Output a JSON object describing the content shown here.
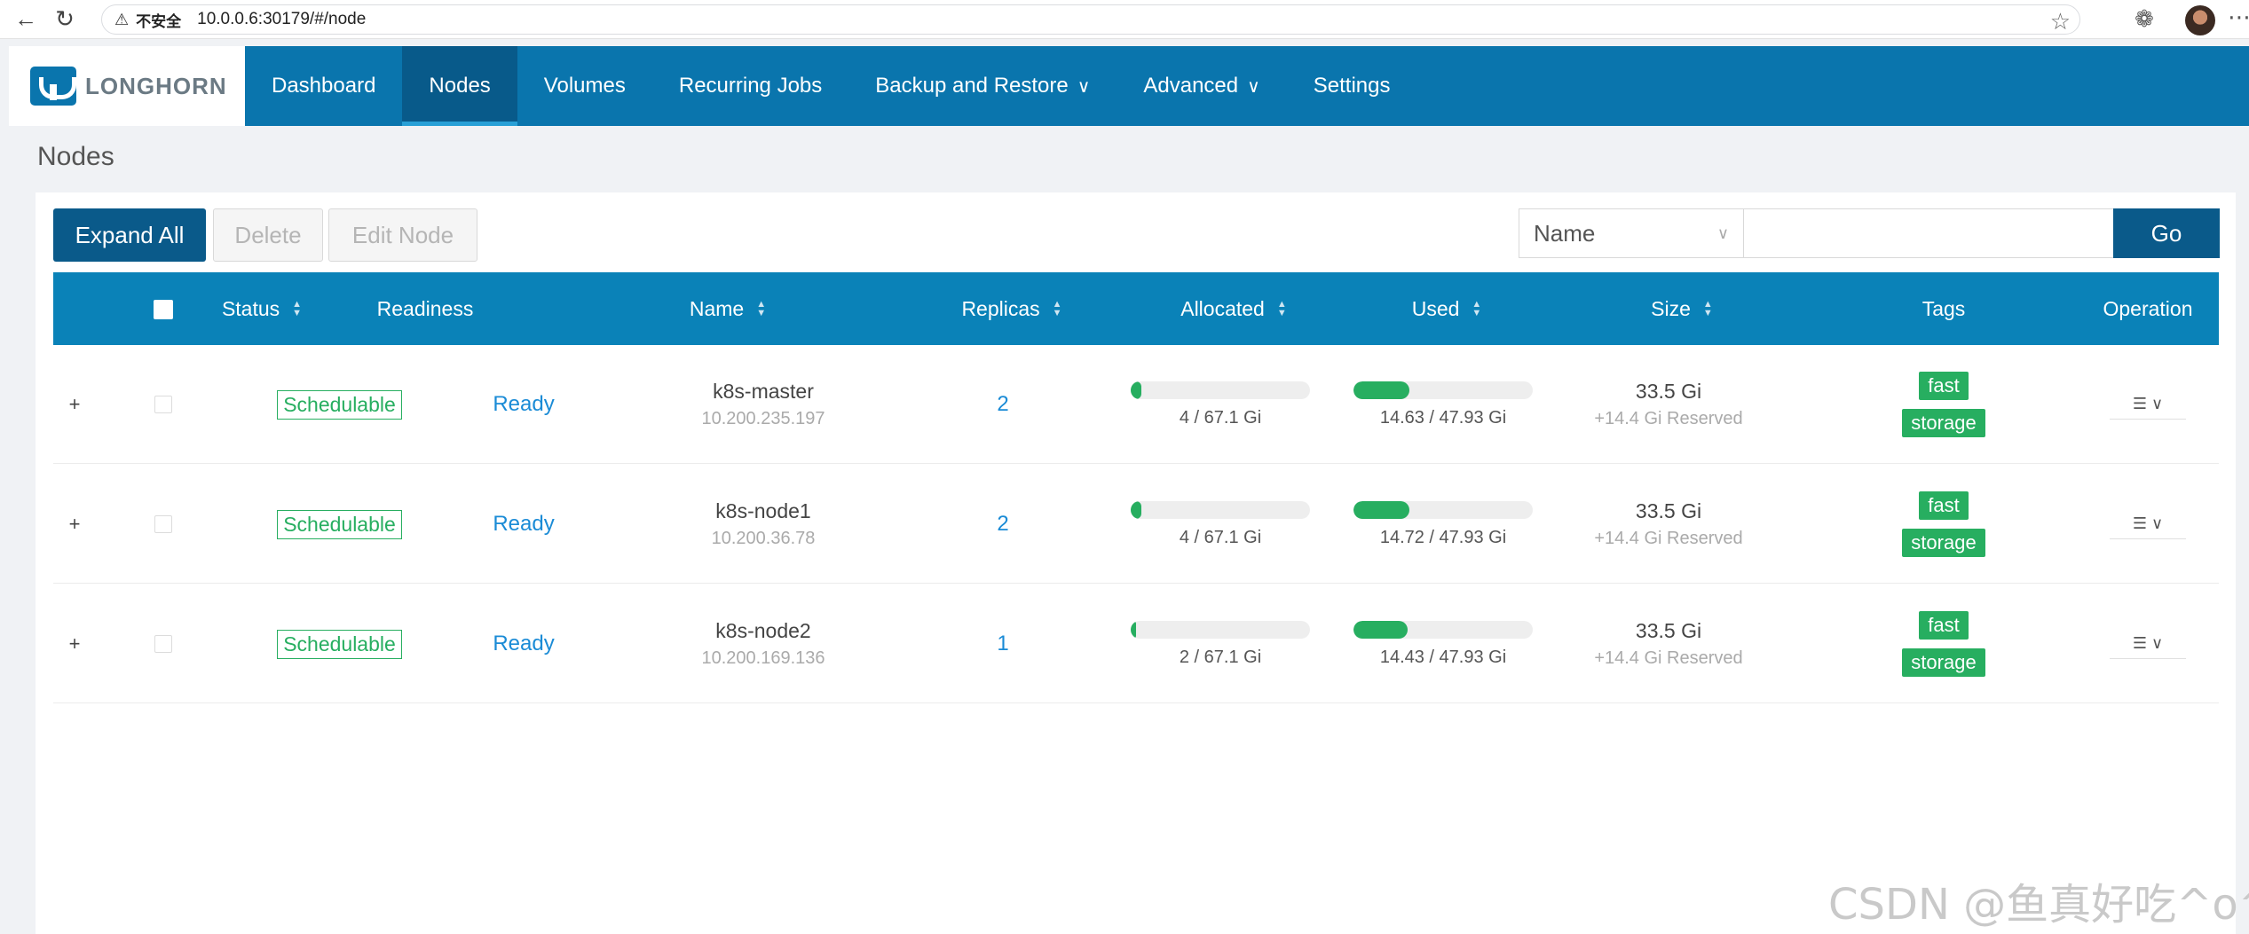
{
  "browser": {
    "insecure_label": "不安全",
    "url": "10.0.0.6:30179/#/node"
  },
  "header": {
    "logo_text": "LONGHORN",
    "nav": [
      {
        "label": "Dashboard"
      },
      {
        "label": "Nodes",
        "active": true
      },
      {
        "label": "Volumes"
      },
      {
        "label": "Recurring Jobs"
      },
      {
        "label": "Backup and Restore",
        "has_dropdown": true
      },
      {
        "label": "Advanced",
        "has_dropdown": true
      },
      {
        "label": "Settings"
      }
    ]
  },
  "page": {
    "title": "Nodes"
  },
  "toolbar": {
    "expand_all": "Expand All",
    "delete": "Delete",
    "edit_node": "Edit Node",
    "search_field": "Name",
    "search_value": "",
    "go": "Go"
  },
  "table": {
    "columns": {
      "status": "Status",
      "readiness": "Readiness",
      "name": "Name",
      "replicas": "Replicas",
      "allocated": "Allocated",
      "used": "Used",
      "size": "Size",
      "tags": "Tags",
      "operation": "Operation"
    },
    "rows": [
      {
        "expand": "+",
        "status": "Schedulable",
        "readiness": "Ready",
        "name": "k8s-master",
        "ip": "10.200.235.197",
        "replicas": "2",
        "allocated": "4 / 67.1 Gi",
        "allocated_fraction": 0.06,
        "used": "14.63 / 47.93 Gi",
        "used_fraction": 0.31,
        "size": "33.5 Gi",
        "reserved": "+14.4 Gi Reserved",
        "tags": [
          "fast",
          "storage"
        ]
      },
      {
        "expand": "+",
        "status": "Schedulable",
        "readiness": "Ready",
        "name": "k8s-node1",
        "ip": "10.200.36.78",
        "replicas": "2",
        "allocated": "4 / 67.1 Gi",
        "allocated_fraction": 0.06,
        "used": "14.72 / 47.93 Gi",
        "used_fraction": 0.31,
        "size": "33.5 Gi",
        "reserved": "+14.4 Gi Reserved",
        "tags": [
          "fast",
          "storage"
        ]
      },
      {
        "expand": "+",
        "status": "Schedulable",
        "readiness": "Ready",
        "name": "k8s-node2",
        "ip": "10.200.169.136",
        "replicas": "1",
        "allocated": "2 / 67.1 Gi",
        "allocated_fraction": 0.03,
        "used": "14.43 / 47.93 Gi",
        "used_fraction": 0.3,
        "size": "33.5 Gi",
        "reserved": "+14.4 Gi Reserved",
        "tags": [
          "fast",
          "storage"
        ]
      }
    ]
  },
  "watermark": "CSDN @鱼真好吃^o^",
  "colors": {
    "brand": "#0a75ad",
    "header_table": "#0a82b8",
    "success": "#27ae60",
    "link": "#1a8bd6"
  }
}
